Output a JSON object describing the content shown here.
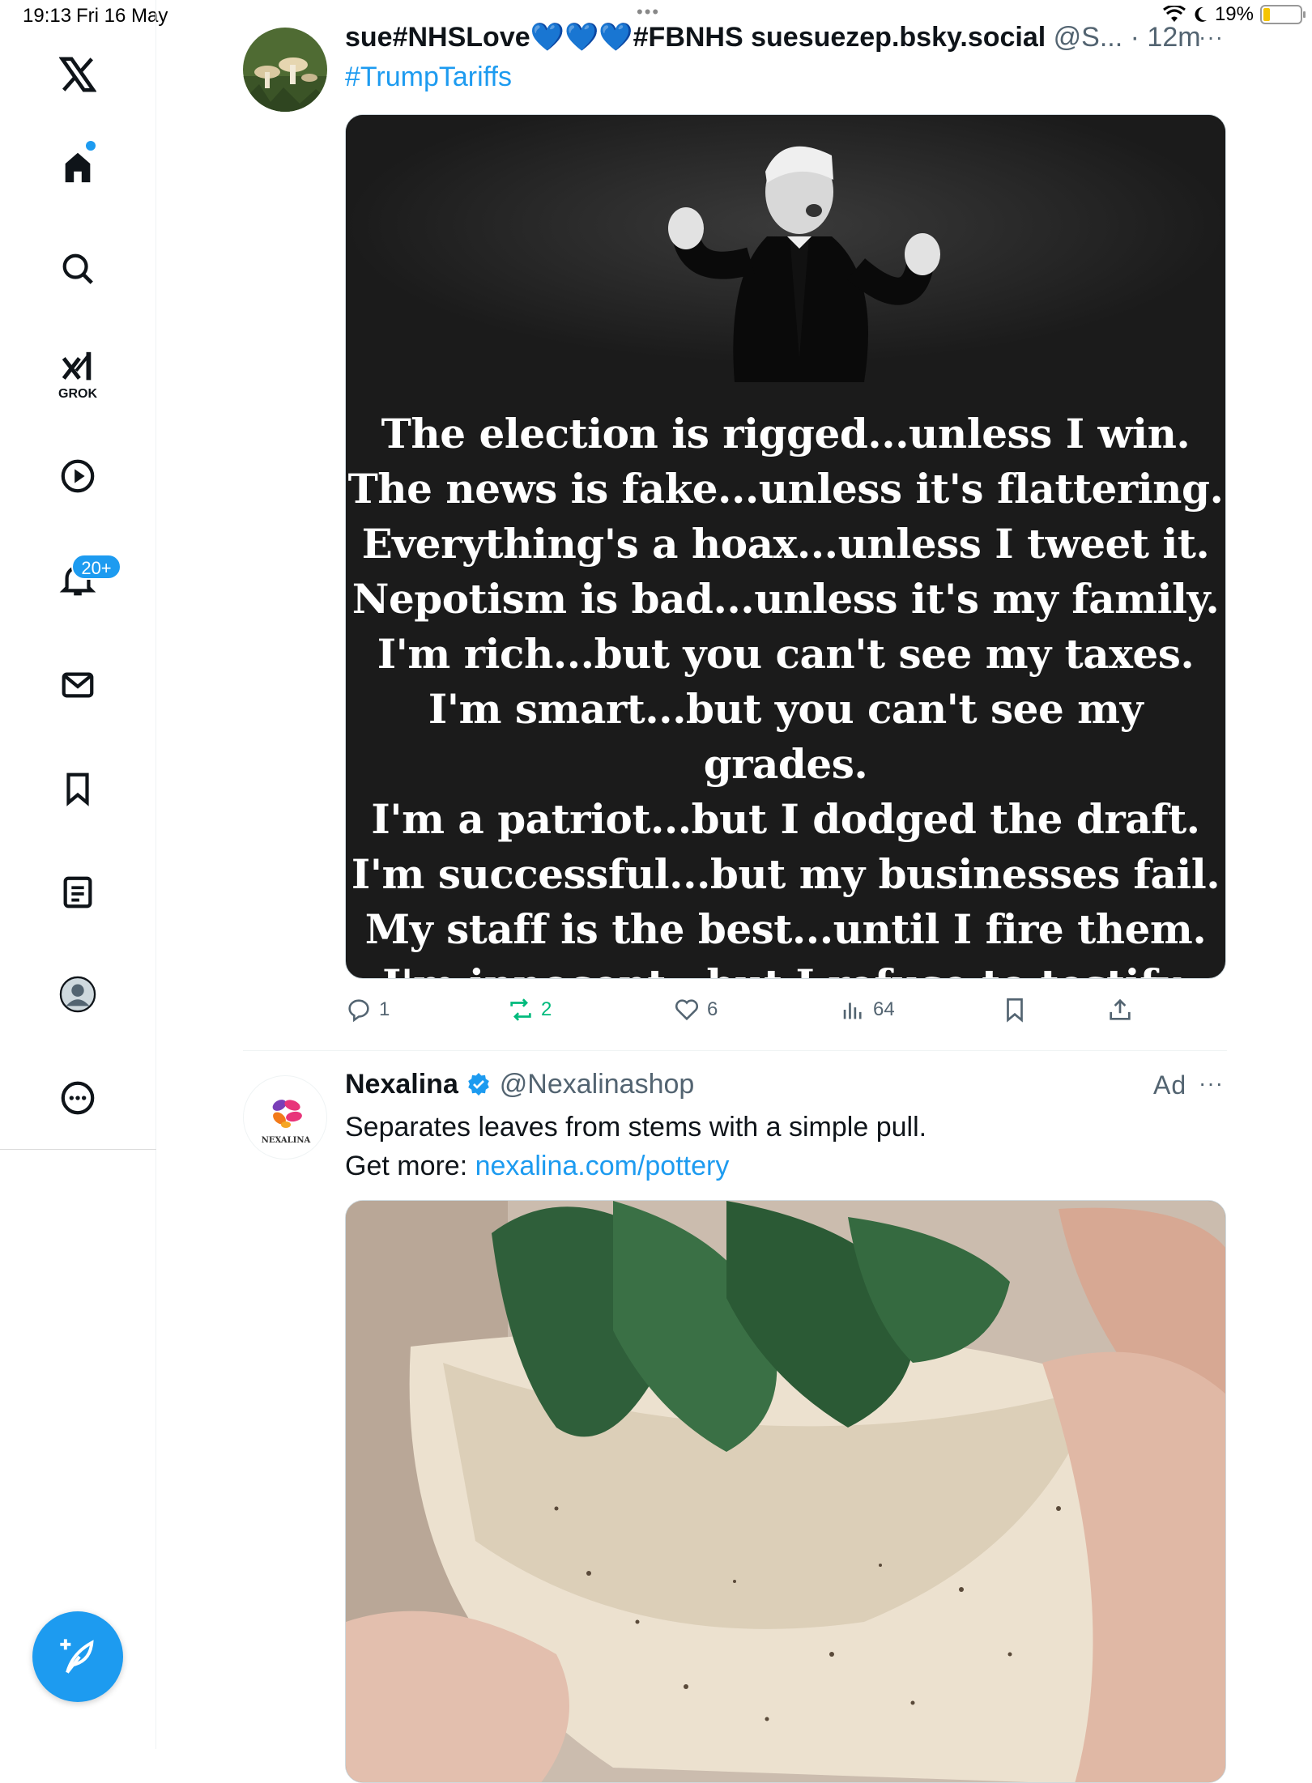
{
  "status_bar": {
    "time": "19:13",
    "date": "Fri 16 May",
    "battery": "19%",
    "battery_level": 0.19
  },
  "sidebar": {
    "items": [
      {
        "name": "home",
        "icon": "home-icon"
      },
      {
        "name": "search",
        "icon": "search-icon"
      },
      {
        "name": "grok",
        "icon": "grok-icon",
        "label": "GROK"
      },
      {
        "name": "video",
        "icon": "play-icon"
      },
      {
        "name": "notifications",
        "icon": "bell-icon",
        "badge": "20+"
      },
      {
        "name": "messages",
        "icon": "mail-icon"
      },
      {
        "name": "bookmarks",
        "icon": "bookmark-icon"
      },
      {
        "name": "lists",
        "icon": "list-icon"
      },
      {
        "name": "profile",
        "icon": "profile-icon"
      },
      {
        "name": "more",
        "icon": "more-icon"
      }
    ],
    "compose_icon": "compose-icon"
  },
  "post1": {
    "display_name": "sue#NHSLove💙💙💙#FBNHS suesuezep.bsky.social",
    "handle": "@S...",
    "time": "· 12m",
    "more": "···",
    "hashtag": "#TrumpTariffs",
    "image_lines": [
      "The election is rigged...unless I win.",
      "The news is fake...unless it's flattering.",
      "Everything's a hoax...unless I tweet it.",
      "Nepotism is bad...unless it's my family.",
      "I'm rich...but you can't see my taxes.",
      "I'm smart...but you can't see my grades.",
      "I'm a patriot...but I dodged the draft.",
      "I'm successful...but my businesses fail.",
      "My staff is the best...until I fire them.",
      "I'm innocent...but I refuse to testify."
    ],
    "replies": "1",
    "reposts": "2",
    "likes": "6",
    "views": "64",
    "repost_color": "#00ba7c"
  },
  "post2": {
    "display_name": "Nexalina",
    "handle": "@Nexalinashop",
    "ad_label": "Ad",
    "more": "···",
    "avatar_text": "NEXALINA",
    "text": "Separates leaves from stems with a simple pull.",
    "link_prefix": "Get more: ",
    "link": "nexalina.com/pottery"
  },
  "colors": {
    "accent": "#1d9bf0",
    "text": "#0f1419",
    "muted": "#536471"
  }
}
